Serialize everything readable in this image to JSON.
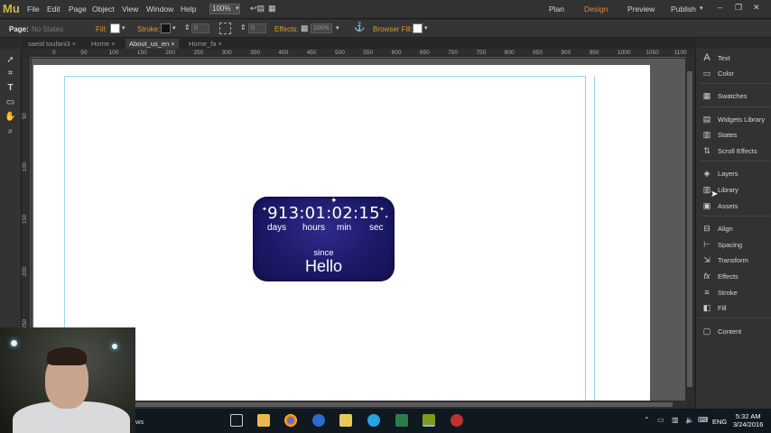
{
  "app": {
    "logo": "Mu"
  },
  "menu": [
    "File",
    "Edit",
    "Page",
    "Object",
    "View",
    "Window",
    "Help"
  ],
  "zoom": "100%",
  "modes": {
    "plan": "Plan",
    "design": "Design",
    "preview": "Preview",
    "publish": "Publish"
  },
  "colors": {
    "accent": "#e8833a",
    "label_orange": "#d99a2b",
    "widget_bg": "#1b1865",
    "guide": "#9fd0f2"
  },
  "controlbar": {
    "page_label": "Page:",
    "states_label": "No States",
    "fill_label": "Fill:",
    "stroke_label": "Stroke:",
    "stroke_value": "0",
    "rotation_value": "0",
    "effects_label": "Effects:",
    "effects_value": "100%",
    "browser_fill_label": "Browser Fill:"
  },
  "tabs": [
    {
      "label": "saeid toufani3",
      "active": false
    },
    {
      "label": "Home",
      "active": false
    },
    {
      "label": "About_us_en",
      "active": true
    },
    {
      "label": "Home_fa",
      "active": false
    }
  ],
  "ruler": {
    "h_ticks": [
      "0",
      "50",
      "100",
      "150",
      "200",
      "250",
      "300",
      "350",
      "400",
      "450",
      "500",
      "550",
      "600",
      "650",
      "700",
      "750",
      "800",
      "850",
      "900",
      "950",
      "1000",
      "1050",
      "1100"
    ],
    "v_ticks": [
      "50",
      "100",
      "150",
      "200",
      "250",
      "300",
      "350"
    ]
  },
  "widget": {
    "counter": "913:01:02:15",
    "units": [
      "days",
      "hours",
      "min",
      "sec"
    ],
    "since": "since",
    "title": "Hello"
  },
  "panels": [
    {
      "label": "Text",
      "icon": "text-icon"
    },
    {
      "label": "Color",
      "icon": "color-icon"
    },
    {
      "label": "Swatches",
      "icon": "swatches-icon"
    },
    {
      "label": "Widgets Library",
      "icon": "widgets-icon"
    },
    {
      "label": "States",
      "icon": "states-icon"
    },
    {
      "label": "Scroll Effects",
      "icon": "scroll-effects-icon"
    },
    {
      "label": "Layers",
      "icon": "layers-icon"
    },
    {
      "label": "Library",
      "icon": "library-icon"
    },
    {
      "label": "Assets",
      "icon": "assets-icon"
    },
    {
      "label": "Align",
      "icon": "align-icon"
    },
    {
      "label": "Spacing",
      "icon": "spacing-icon"
    },
    {
      "label": "Transform",
      "icon": "transform-icon"
    },
    {
      "label": "Effects",
      "icon": "effects-icon"
    },
    {
      "label": "Stroke",
      "icon": "stroke-icon"
    },
    {
      "label": "Fill",
      "icon": "fill-icon"
    },
    {
      "label": "Content",
      "icon": "content-icon"
    }
  ],
  "taskbar": {
    "search_partial": "ws",
    "lang": "ENG",
    "time": "5:32 AM",
    "date": "3/24/2016"
  }
}
